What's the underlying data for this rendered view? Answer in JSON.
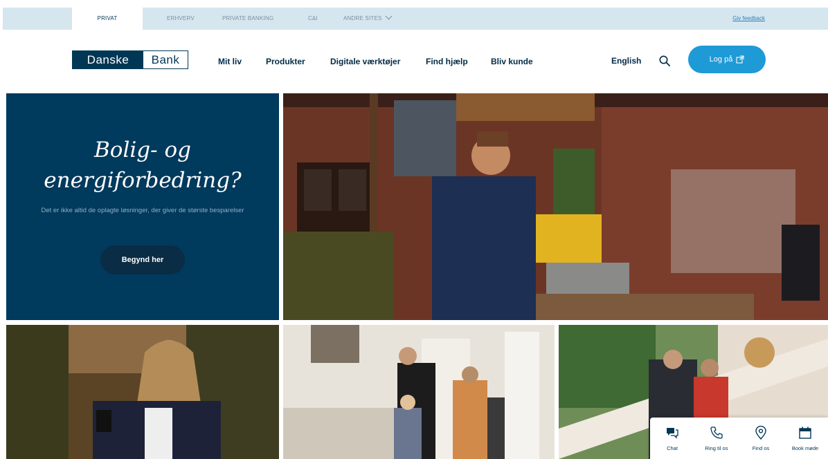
{
  "topbar": {
    "tabs": [
      {
        "label": "PRIVAT",
        "active": true
      },
      {
        "label": "ERHVERV"
      },
      {
        "label": "PRIVATE BANKING"
      },
      {
        "label": "C&I"
      },
      {
        "label": "ANDRE SITES"
      }
    ],
    "feedback_label": "Giv feedback"
  },
  "header": {
    "logo": {
      "part1": "Danske",
      "part2": "Bank"
    },
    "nav": [
      "Mit liv",
      "Produkter",
      "Digitale værktøjer",
      "Find hjælp",
      "Bliv kunde"
    ],
    "language": "English",
    "search_icon": "search-icon",
    "login_label": "Log på"
  },
  "hero": {
    "title": "Bolig- og energiforbedring?",
    "subtitle": "Det er ikke altid de oplagte løsninger, der giver de største besparelser",
    "cta": "Begynd her"
  },
  "quick_actions": [
    {
      "label": "Chat",
      "icon": "chat-icon"
    },
    {
      "label": "Ring til os",
      "icon": "phone-icon"
    },
    {
      "label": "Find os",
      "icon": "location-pin-icon"
    },
    {
      "label": "Book møde",
      "icon": "calendar-icon"
    }
  ],
  "colors": {
    "brand_navy": "#003755",
    "hero_bg": "#003a5d",
    "accent_blue": "#1e9ad6",
    "topbar_bg": "#d5e6ef"
  }
}
